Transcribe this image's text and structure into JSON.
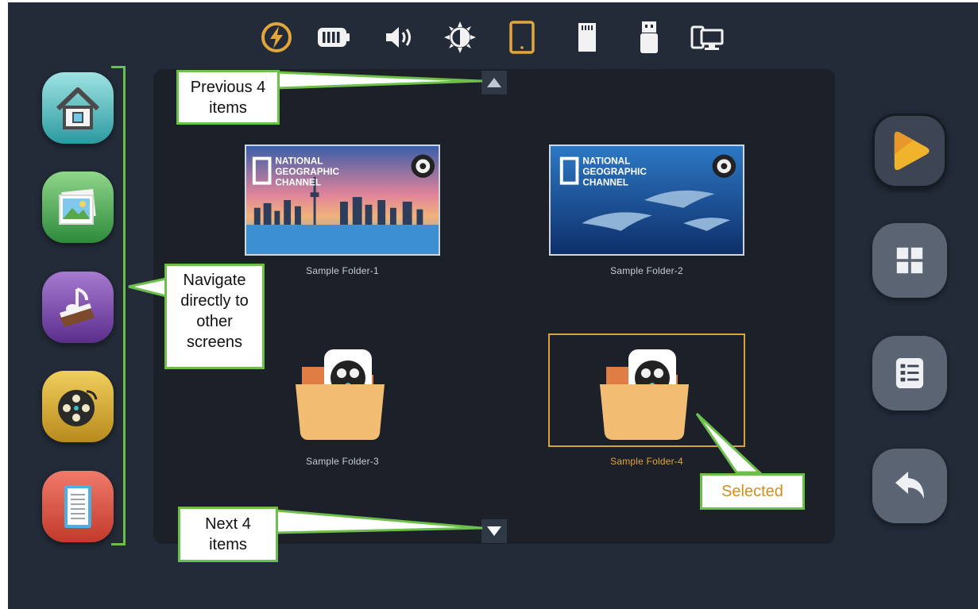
{
  "status_bar": {
    "icons": [
      "charging-icon",
      "battery-icon",
      "volume-icon",
      "brightness-icon",
      "tablet-icon",
      "sd-card-icon",
      "usb-drive-icon",
      "display-devices-icon"
    ],
    "active_icon": "tablet-icon"
  },
  "left_nav": {
    "items": [
      "home",
      "photos",
      "music",
      "videos",
      "documents"
    ],
    "active": "videos"
  },
  "right_nav": {
    "items": [
      "media-player",
      "grid-view",
      "list-view",
      "back"
    ],
    "active": "media-player"
  },
  "grid": {
    "folders": [
      {
        "label": "Sample Folder-1",
        "thumb_text": "NATIONAL\nGEOGRAPHIC\nCHANNEL"
      },
      {
        "label": "Sample Folder-2",
        "thumb_text": "NATIONAL\nGEOGRAPHIC\nCHANNEL"
      },
      {
        "label": "Sample Folder-3"
      },
      {
        "label": "Sample Folder-4",
        "selected": true
      }
    ],
    "thumb_lines": [
      "NATIONAL",
      "GEOGRAPHIC",
      "CHANNEL"
    ]
  },
  "annotations": {
    "prev": "Previous 4 items",
    "prev_lines": [
      "Previous 4",
      "items"
    ],
    "next_lines": [
      "Next 4",
      "items"
    ],
    "navigate_lines": [
      "Navigate",
      "directly to",
      "other",
      "screens"
    ],
    "selected": "Selected"
  },
  "colors": {
    "background": "#232b38",
    "panel": "#1b2029",
    "accent": "#e2a63b",
    "callout_border": "#6cc04a"
  }
}
